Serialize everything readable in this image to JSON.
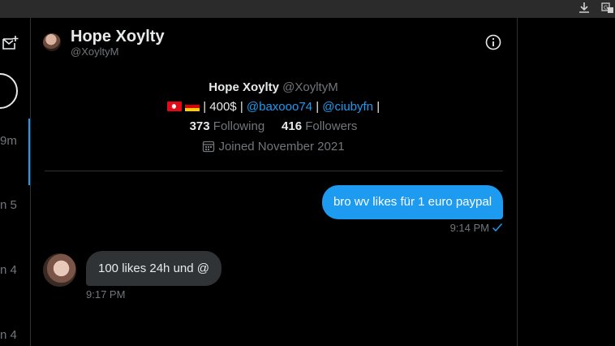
{
  "browser": {
    "icons": [
      "download-icon",
      "translate-icon"
    ]
  },
  "sidebar": {
    "times": [
      "9m",
      "n 5",
      "n 4",
      "n 4"
    ]
  },
  "header": {
    "name": "Hope Xoylty",
    "handle": "@XoyltyM"
  },
  "profile": {
    "name": "Hope Xoylty",
    "handle": "@XoyltyM",
    "bio_price": "| 400$ |",
    "bio_link1": "@baxooo74",
    "bio_sep": "|",
    "bio_link2": "@ciubyfn",
    "bio_end": "|",
    "following_count": "373",
    "following_label": "Following",
    "followers_count": "416",
    "followers_label": "Followers",
    "joined": "Joined November 2021"
  },
  "messages": [
    {
      "direction": "out",
      "text": "bro wv likes für 1 euro paypal",
      "time": "9:14 PM"
    },
    {
      "direction": "in",
      "text": "100 likes 24h und @",
      "time": "9:17 PM"
    }
  ],
  "colors": {
    "accent": "#1d9bf0",
    "background": "#000000",
    "bubble_in": "#2f3336",
    "muted": "#71767b"
  }
}
